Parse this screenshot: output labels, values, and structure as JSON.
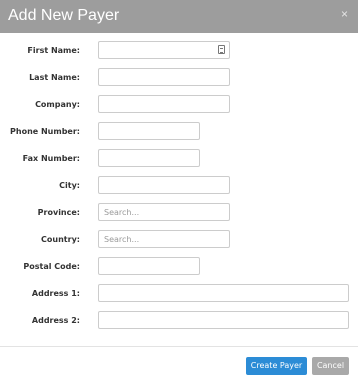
{
  "dialog": {
    "title": "Add New Payer",
    "close_label": "×"
  },
  "fields": {
    "first_name": {
      "label": "First Name:",
      "value": ""
    },
    "last_name": {
      "label": "Last Name:",
      "value": ""
    },
    "company": {
      "label": "Company:",
      "value": ""
    },
    "phone": {
      "label": "Phone Number:",
      "value": ""
    },
    "fax": {
      "label": "Fax Number:",
      "value": ""
    },
    "city": {
      "label": "City:",
      "value": ""
    },
    "province": {
      "label": "Province:",
      "placeholder": "Search..."
    },
    "country": {
      "label": "Country:",
      "placeholder": "Search..."
    },
    "postal_code": {
      "label": "Postal Code:",
      "value": ""
    },
    "address1": {
      "label": "Address 1:",
      "value": ""
    },
    "address2": {
      "label": "Address 2:",
      "value": ""
    }
  },
  "footer": {
    "create_label": "Create Payer",
    "cancel_label": "Cancel"
  },
  "colors": {
    "header_bg": "#9d9d9d",
    "primary_button": "#2c8cd6",
    "secondary_button": "#a9a9a9"
  },
  "icons": {
    "first_name_field_icon": "contact-card-icon"
  }
}
